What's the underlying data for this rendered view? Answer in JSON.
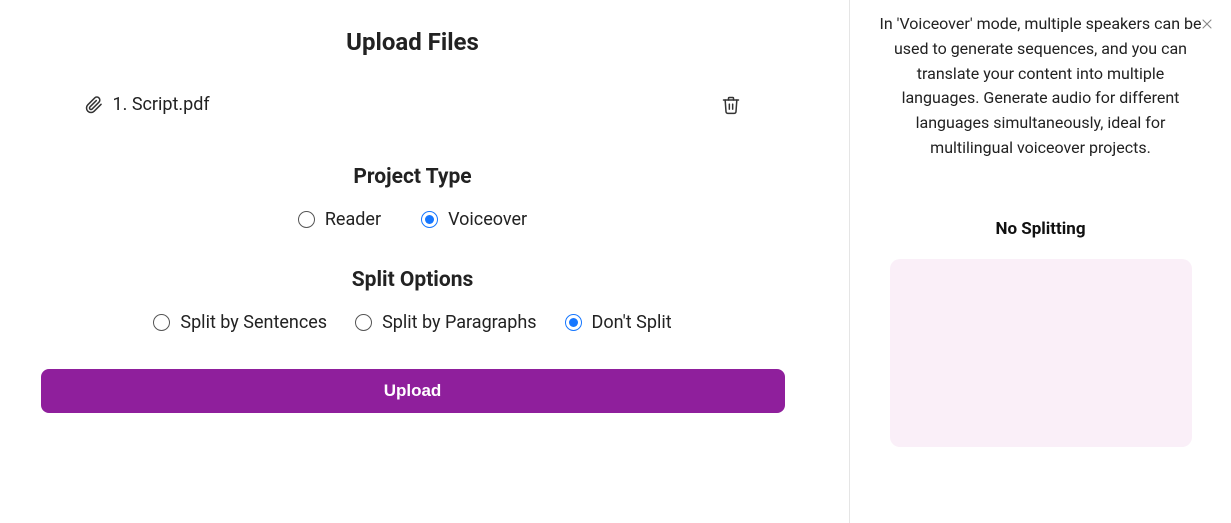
{
  "page_title": "Upload Files",
  "file": {
    "label": "1. Script.pdf"
  },
  "project_type": {
    "title": "Project Type",
    "options": {
      "reader": "Reader",
      "voiceover": "Voiceover"
    },
    "selected": "voiceover"
  },
  "split_options": {
    "title": "Split Options",
    "options": {
      "sentences": "Split by Sentences",
      "paragraphs": "Split by Paragraphs",
      "none": "Don't Split"
    },
    "selected": "none"
  },
  "upload_button": "Upload",
  "sidebar": {
    "description": "In 'Voiceover' mode, multiple speakers can be used to generate sequences, and you can translate your content into multiple languages. Generate audio for different languages simultaneously, ideal for multilingual voiceover projects.",
    "preview_title": "No Splitting"
  }
}
